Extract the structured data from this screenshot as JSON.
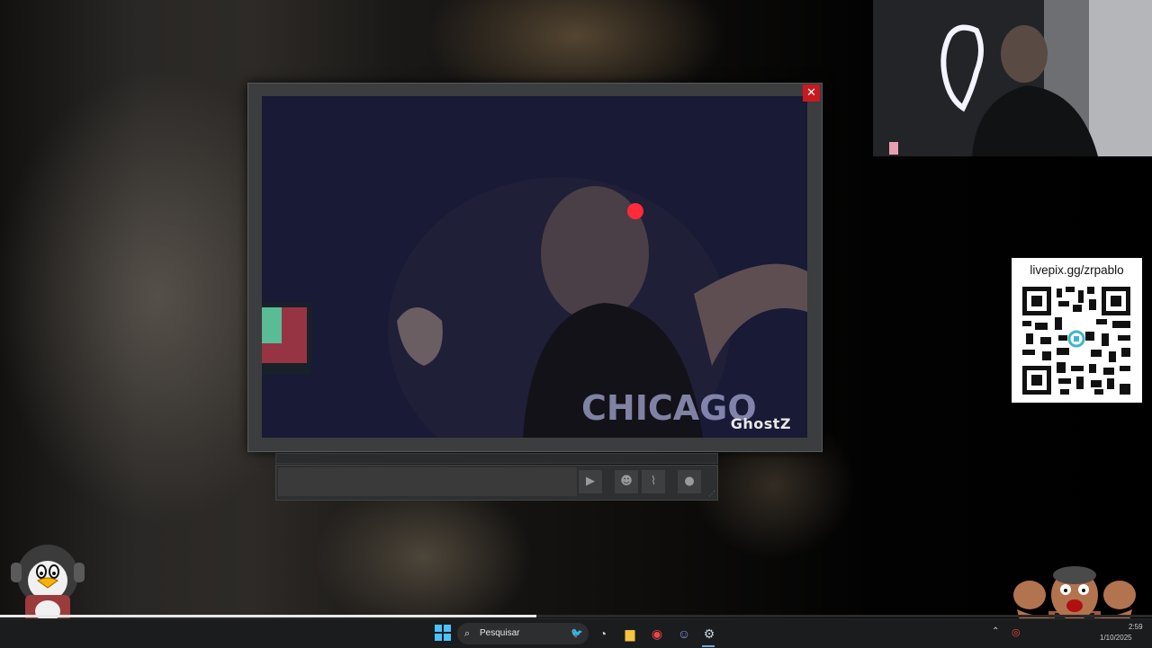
{
  "popup": {
    "close_label": "✕",
    "watermark": "GhostZ"
  },
  "chat": {
    "input_placeholder": "",
    "send_icon": "send-icon",
    "emoji_icon": "emoji-icon",
    "attach_icon": "paperclip-icon",
    "mic_icon": "microphone-icon"
  },
  "qr_panel": {
    "label": "livepix.gg/zrpablo"
  },
  "progress": {
    "fraction": 0.466
  },
  "taskbar": {
    "search_placeholder": "Pesquisar",
    "clock_time": "2:59",
    "clock_date": "1/10/2025"
  },
  "colors": {
    "close_button": "#c8191f",
    "taskbar": "#1b1c1e",
    "popup_frame": "#3c3d3f"
  }
}
